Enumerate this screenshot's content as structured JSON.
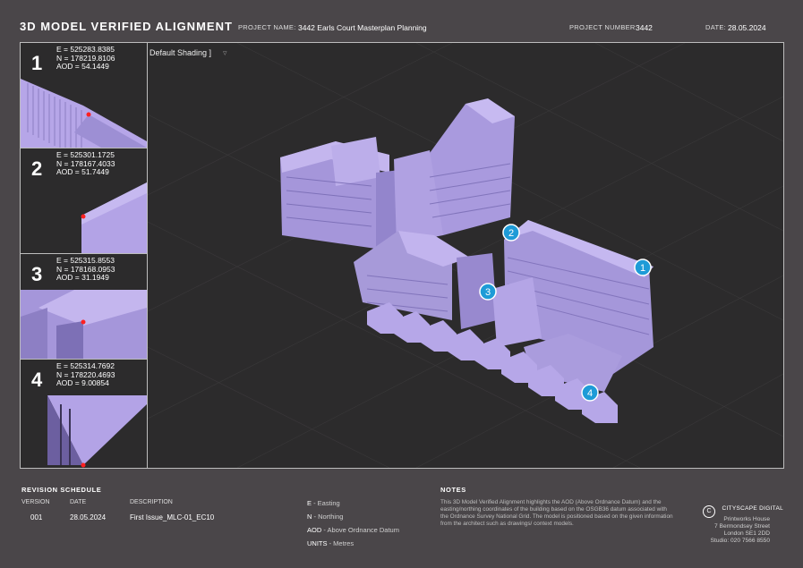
{
  "header": {
    "title": "3D MODEL VERIFIED ALIGNMENT",
    "project_name_label": "PROJECT NAME:",
    "project_name": "3442 Earls Court Masterplan Planning",
    "project_number_label": "PROJECT NUMBER:",
    "project_number": "3442",
    "date_label": "DATE:",
    "date": "28.05.2024"
  },
  "viewport": {
    "label": "Default Shading ]",
    "filter_icon": "funnel-icon",
    "markers": [
      "1",
      "2",
      "3",
      "4"
    ]
  },
  "points": [
    {
      "num": "1",
      "e": "E = 525283.8385",
      "n": "N = 178219.8106",
      "aod": "AOD = 54.1449"
    },
    {
      "num": "2",
      "e": "E = 525301.1725",
      "n": "N = 178167.4033",
      "aod": "AOD = 51.7449"
    },
    {
      "num": "3",
      "e": "E = 525315.8553",
      "n": "N = 178168.0953",
      "aod": "AOD = 31.1949"
    },
    {
      "num": "4",
      "e": "E = 525314.7692",
      "n": "N = 178220.4693",
      "aod": "AOD = 9.00854"
    }
  ],
  "revision": {
    "title": "REVISION SCHEDULE",
    "headers": [
      "VERSION",
      "DATE",
      "DESCRIPTION"
    ],
    "rows": [
      [
        "001",
        "28.05.2024",
        "First Issue_MLC-01_EC10"
      ]
    ]
  },
  "legend": [
    {
      "key": "E",
      "text": " - Easting"
    },
    {
      "key": "N",
      "text": " - Northing"
    },
    {
      "key": "AOD",
      "text": " - Above Ordnance Datum"
    },
    {
      "key": "UNITS",
      "text": " - Metres"
    }
  ],
  "notes": {
    "title": "NOTES",
    "text": "This 3D Model Verified Alignment highlights the AOD (Above Ordnance Datum) and the easting/northing coordinates of the building based on the OSGB36 datum associated with the Ordnance Survey National Grid. The model is positioned based on the given information from the architect such as drawings/ context models."
  },
  "company": {
    "logo_letter": "C",
    "name": "CITYSCAPE DIGITAL",
    "address": [
      "Printworks House",
      "7 Bermondsey Street",
      "London SE1 2DD",
      "Studio: 020 7566 8550"
    ]
  },
  "colors": {
    "background": "#4a4649",
    "viewport": "#2c2b2c",
    "model": "#b3a3e6",
    "marker": "#1e9bd7",
    "point": "#ff2020"
  }
}
